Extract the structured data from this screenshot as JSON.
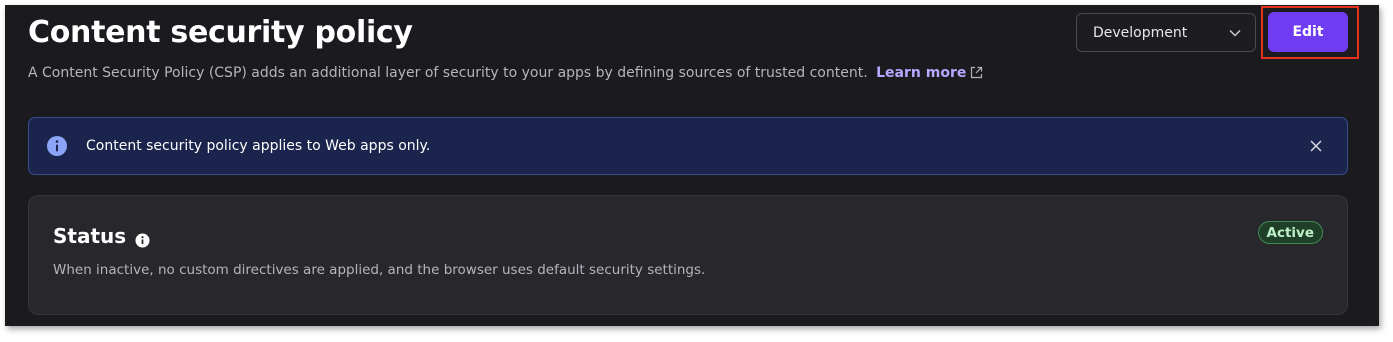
{
  "header": {
    "title": "Content security policy",
    "description": "A Content Security Policy (CSP) adds an additional layer of security to your apps by defining sources of trusted content.",
    "learn_more": "Learn more",
    "learn_more_icon": "external-link-icon"
  },
  "environment_select": {
    "value": "Development",
    "icon": "chevron-down-icon"
  },
  "edit_button": {
    "label": "Edit",
    "highlight_color": "#e5321e"
  },
  "banner": {
    "icon": "info-icon",
    "message": "Content security policy applies to Web apps only.",
    "close_icon": "close-icon"
  },
  "status_card": {
    "title": "Status",
    "title_icon": "info-icon",
    "description": "When inactive, no custom directives are applied, and the browser uses default security settings.",
    "badge": "Active"
  },
  "colors": {
    "accent": "#6f3cf2",
    "link": "#b7a7ff",
    "info_banner_bg": "#1a244d",
    "active_badge": "#3f8a52"
  }
}
